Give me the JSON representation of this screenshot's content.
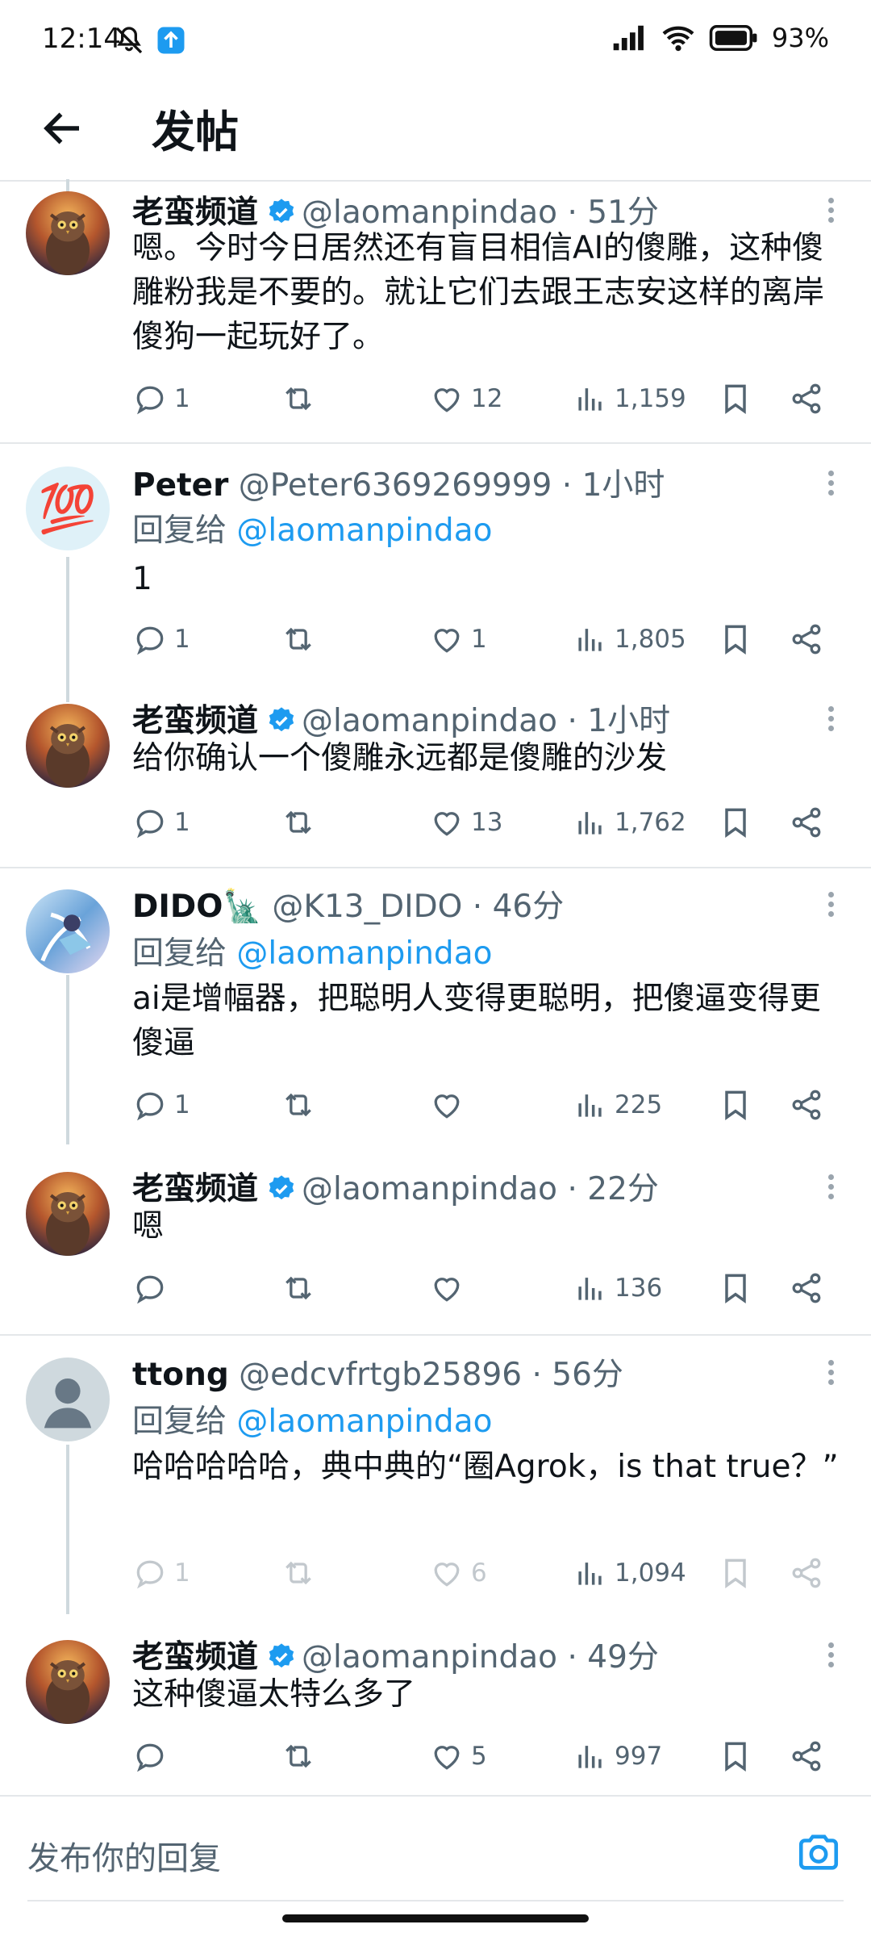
{
  "status": {
    "time": "12:14",
    "battery": "93%"
  },
  "header": {
    "title": "发帖"
  },
  "tweets": [
    {
      "name": "老蛮频道",
      "handle": "@laomanpindao",
      "time": "51分",
      "text": "嗯。今时今日居然还有盲目相信AI的傻雕，这种傻雕粉我是不要的。就让它们去跟王志安这样的离岸傻狗一起玩好了。",
      "replies": "1",
      "retweets": "",
      "likes": "12",
      "views": "1,159"
    },
    {
      "name": "Peter",
      "handle": "@Peter6369269999",
      "time": "1小时",
      "reply_prefix": "回复给",
      "reply_to": "@laomanpindao",
      "text": "1",
      "replies": "1",
      "retweets": "",
      "likes": "1",
      "views": "1,805",
      "avatar_emoji": "💯"
    },
    {
      "name": "老蛮频道",
      "handle": "@laomanpindao",
      "time": "1小时",
      "text": "给你确认一个傻雕永远都是傻雕的沙发",
      "replies": "1",
      "retweets": "",
      "likes": "13",
      "views": "1,762"
    },
    {
      "name": "DIDO🗽",
      "handle": "@K13_DIDO",
      "time": "46分",
      "reply_prefix": "回复给",
      "reply_to": "@laomanpindao",
      "text": "ai是增幅器，把聪明人变得更聪明，把傻逼变得更傻逼",
      "replies": "1",
      "retweets": "",
      "likes": "",
      "views": "225"
    },
    {
      "name": "老蛮频道",
      "handle": "@laomanpindao",
      "time": "22分",
      "text": "嗯",
      "replies": "",
      "retweets": "",
      "likes": "",
      "views": "136"
    },
    {
      "name": "ttong",
      "handle": "@edcvfrtgb25896",
      "time": "56分",
      "reply_prefix": "回复给",
      "reply_to": "@laomanpindao",
      "text": "哈哈哈哈哈，典中典的“圈Agrok，is that true？”",
      "replies": "1",
      "retweets": "",
      "likes": "6",
      "views": "1,094"
    },
    {
      "name": "老蛮频道",
      "handle": "@laomanpindao",
      "time": "49分",
      "text": "这种傻逼太特么多了",
      "replies": "",
      "retweets": "",
      "likes": "5",
      "views": "997"
    }
  ],
  "composer": {
    "placeholder": "发布你的回复"
  },
  "colors": {
    "accent": "#1d9bf0",
    "text": "#0f1419",
    "muted": "#536471",
    "divider": "#e4e7ea"
  }
}
